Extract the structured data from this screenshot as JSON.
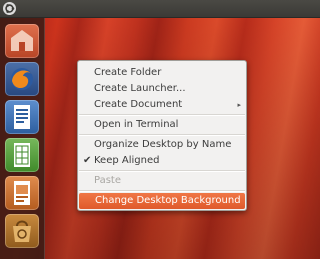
{
  "panel": {
    "logo_icon": "ubuntu-logo-icon"
  },
  "launcher": {
    "items": [
      {
        "name": "home-folder",
        "icon": "home-folder-icon"
      },
      {
        "name": "firefox",
        "icon": "firefox-icon"
      },
      {
        "name": "libreoffice-writer",
        "icon": "writer-icon"
      },
      {
        "name": "libreoffice-calc",
        "icon": "calc-icon"
      },
      {
        "name": "libreoffice-impress",
        "icon": "impress-icon"
      },
      {
        "name": "software-center",
        "icon": "software-center-icon"
      }
    ]
  },
  "context_menu": {
    "create_folder": "Create Folder",
    "create_launcher": "Create Launcher...",
    "create_document": "Create Document",
    "open_terminal": "Open in Terminal",
    "organize": "Organize Desktop by Name",
    "keep_aligned": "Keep Aligned",
    "keep_aligned_check": "✔",
    "paste": "Paste",
    "change_background": "Change Desktop Background",
    "submenu_arrow": "▸"
  },
  "colors": {
    "accent": "#e8643a",
    "menu_bg": "#f2f1f0",
    "launcher_bg": "#3c1c16"
  }
}
